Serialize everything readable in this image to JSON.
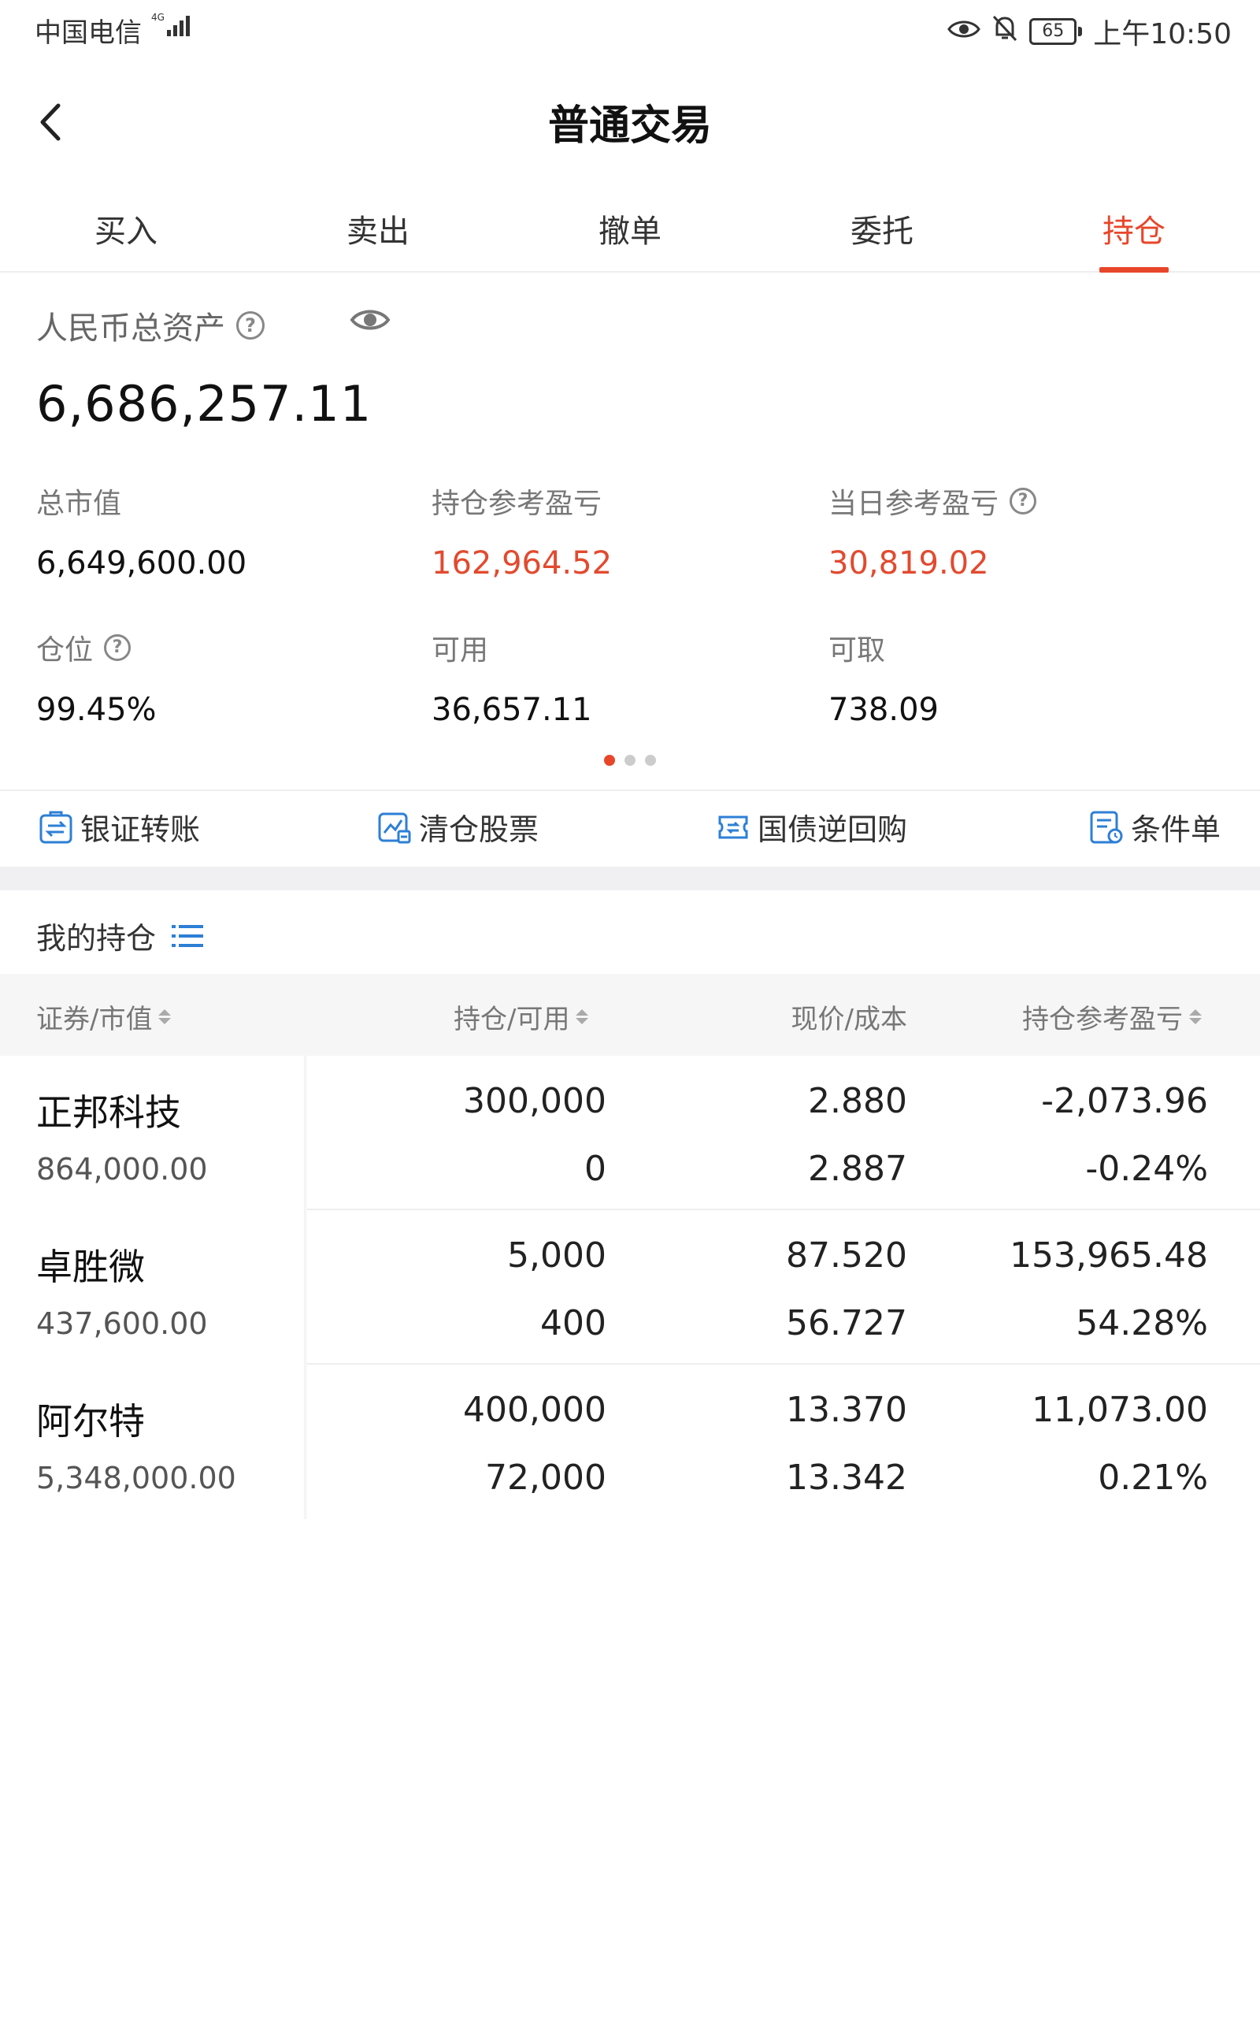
{
  "status_bar": {
    "carrier": "中国电信",
    "network": "4G",
    "battery": "65",
    "time": "上午10:50"
  },
  "header": {
    "title": "普通交易"
  },
  "tabs": [
    {
      "label": "买入",
      "active": false
    },
    {
      "label": "卖出",
      "active": false
    },
    {
      "label": "撤单",
      "active": false
    },
    {
      "label": "委托",
      "active": false
    },
    {
      "label": "持仓",
      "active": true
    }
  ],
  "assets": {
    "label": "人民币总资产",
    "total": "6,686,257.11",
    "metrics": [
      {
        "label": "总市值",
        "value": "6,649,600.00",
        "color": "#111111"
      },
      {
        "label": "持仓参考盈亏",
        "value": "162,964.52",
        "color": "#e24a2f"
      },
      {
        "label": "当日参考盈亏",
        "value": "30,819.02",
        "color": "#e24a2f"
      },
      {
        "label": "仓位",
        "value": "99.45%",
        "color": "#111111"
      },
      {
        "label": "可用",
        "value": "36,657.11",
        "color": "#111111"
      },
      {
        "label": "可取",
        "value": "738.09",
        "color": "#111111"
      }
    ],
    "page_indicator": {
      "count": 3,
      "active": 0
    }
  },
  "quick_actions": [
    {
      "label": "银证转账",
      "icon": "transfer-icon"
    },
    {
      "label": "清仓股票",
      "icon": "clear-stock-icon"
    },
    {
      "label": "国债逆回购",
      "icon": "bond-repo-icon"
    },
    {
      "label": "条件单",
      "icon": "condition-order-icon"
    }
  ],
  "positions": {
    "title": "我的持仓",
    "columns": [
      "证券/市值",
      "持仓/可用",
      "现价/成本",
      "持仓参考盈亏"
    ],
    "rows": [
      {
        "name": "正邦科技",
        "market_value": "864,000.00",
        "holding": "300,000",
        "available": "0",
        "price": "2.880",
        "cost": "2.887",
        "pnl": "-2,073.96",
        "pnl_pct": "-0.24%",
        "trend": "down"
      },
      {
        "name": "卓胜微",
        "market_value": "437,600.00",
        "holding": "5,000",
        "available": "400",
        "price": "87.520",
        "cost": "56.727",
        "pnl": "153,965.48",
        "pnl_pct": "54.28%",
        "trend": "up"
      },
      {
        "name": "阿尔特",
        "market_value": "5,348,000.00",
        "holding": "400,000",
        "available": "72,000",
        "price": "13.370",
        "cost": "13.342",
        "pnl": "11,073.00",
        "pnl_pct": "0.21%",
        "trend": "up"
      }
    ]
  },
  "colors": {
    "accent": "#e8462a",
    "profit": "#e24a2f",
    "loss": "#3aa34a",
    "icon_blue": "#2d7fd6"
  }
}
